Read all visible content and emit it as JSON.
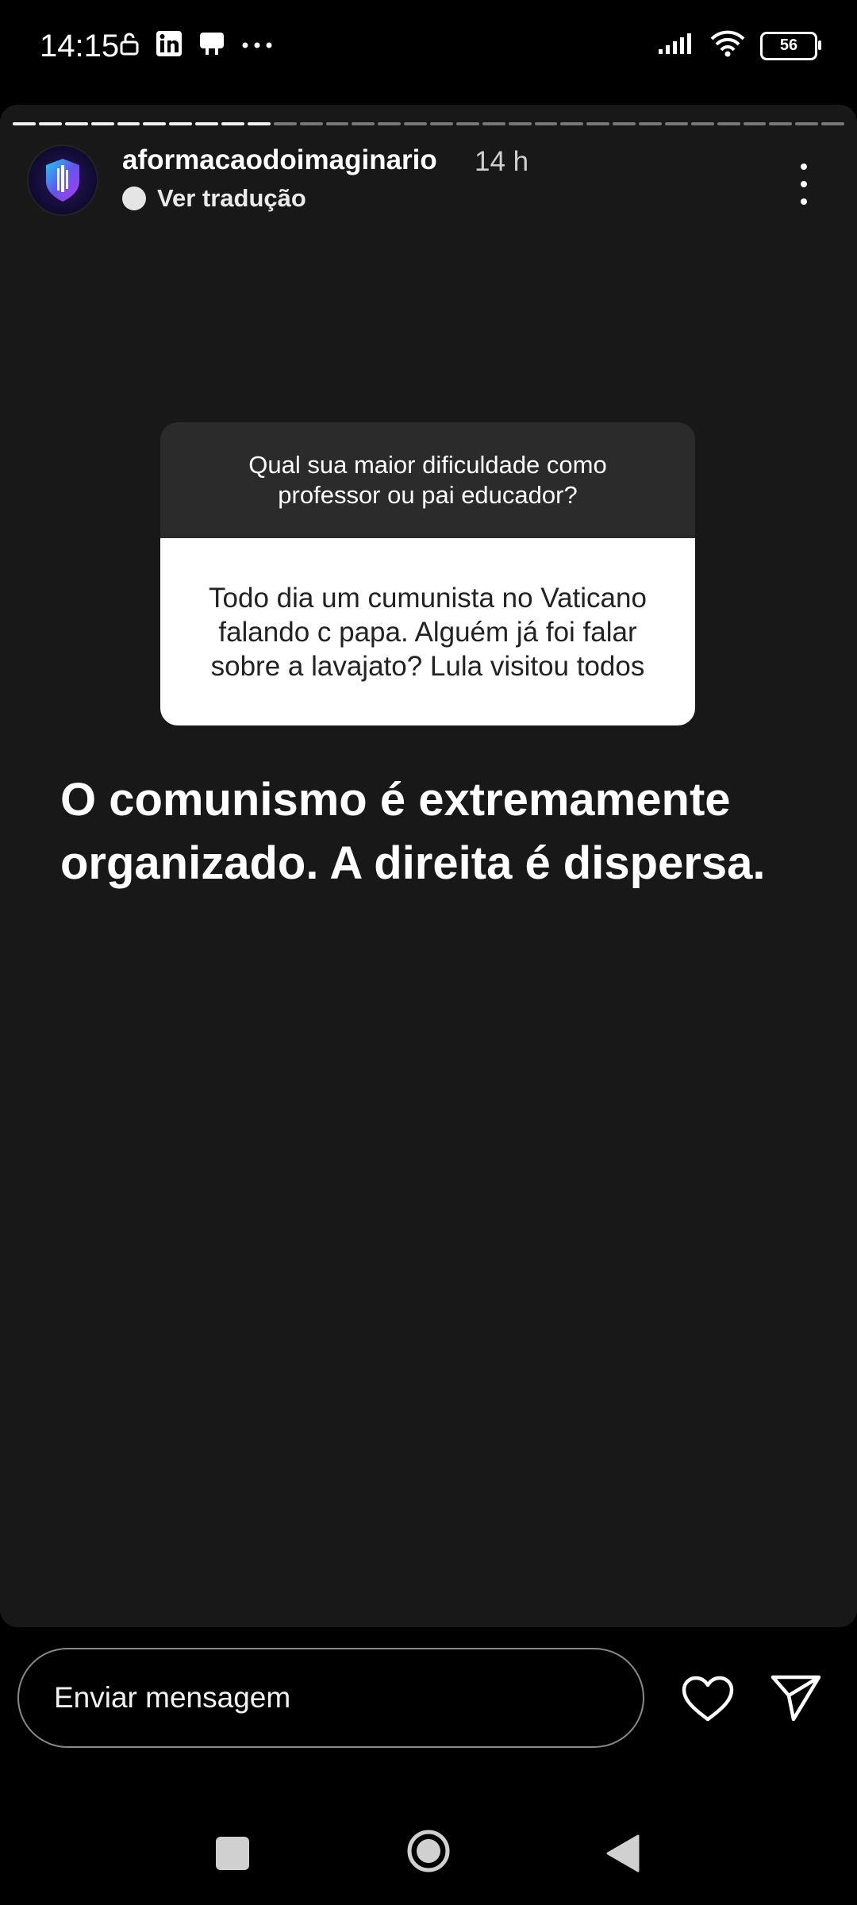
{
  "status_bar": {
    "time": "14:15",
    "left_icons": [
      "lock-icon",
      "linkedin-icon",
      "tv-icon",
      "more-dots-icon"
    ],
    "right_icons": [
      "signal-icon",
      "wifi-icon",
      "battery-icon"
    ],
    "battery_level": "56"
  },
  "story": {
    "username": "aformacaodoimaginario",
    "time_ago": "14 h",
    "translate_label": "Ver tradução",
    "progress": {
      "segments_total": 32,
      "segments_viewed": 10
    }
  },
  "question_card": {
    "question": "Qual sua maior dificuldade como professor ou pai educador?",
    "answer": "Todo dia um cumunista no Vaticano falando c papa. Alguém já foi falar sobre a lavajato? Lula visitou todos"
  },
  "caption": "O comunismo é extremamente organizado. A direita é dispersa.",
  "reply_bar": {
    "placeholder": "Enviar mensagem"
  },
  "colors": {
    "story_background": "#181818",
    "screen_background": "#000000",
    "question_header": "#2b2b2b",
    "answer_background": "#ffffff"
  }
}
